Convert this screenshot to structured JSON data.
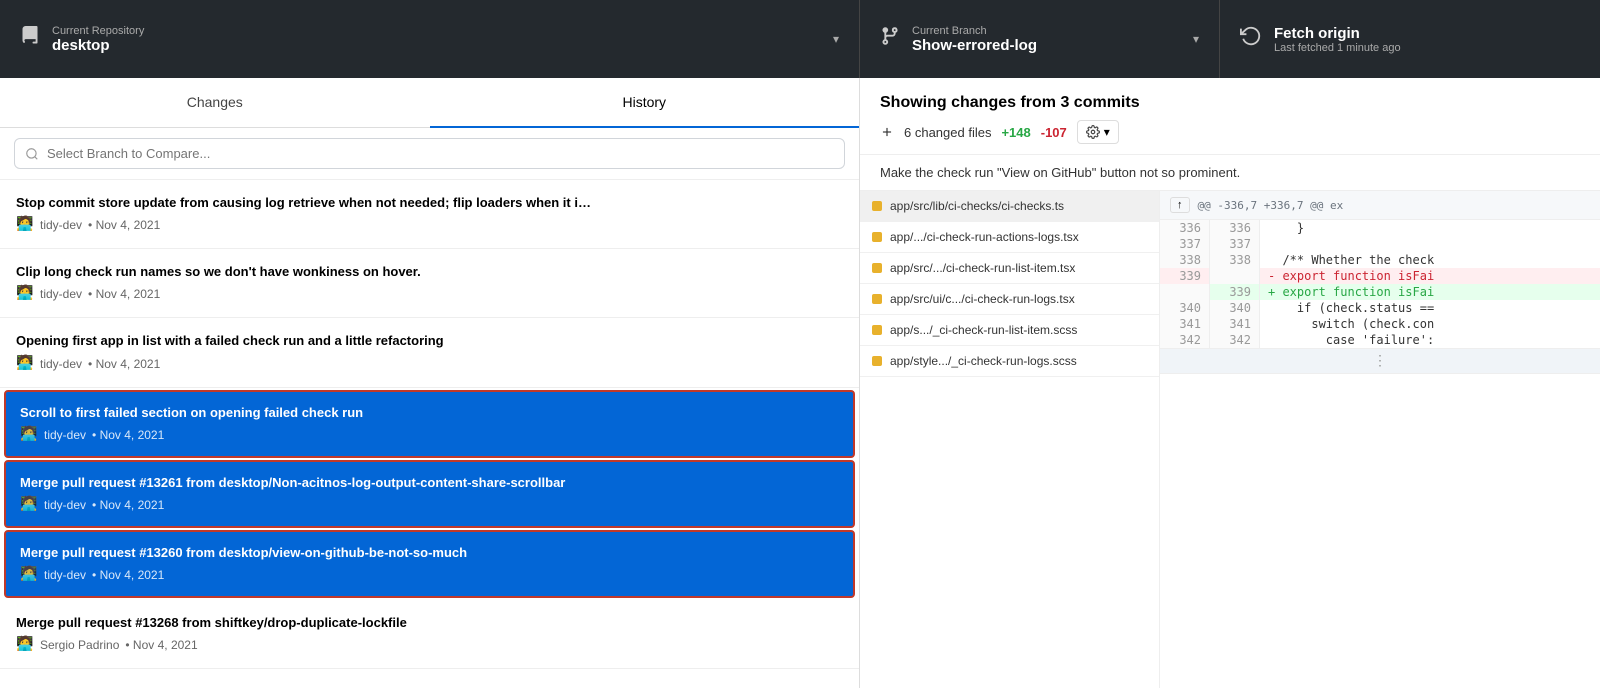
{
  "topbar": {
    "repo_label": "Current Repository",
    "repo_name": "desktop",
    "branch_label": "Current Branch",
    "branch_name": "Show-errored-log",
    "fetch_label": "Fetch origin",
    "fetch_sub": "Last fetched 1 minute ago"
  },
  "tabs": {
    "changes": "Changes",
    "history": "History"
  },
  "search": {
    "placeholder": "Select Branch to Compare..."
  },
  "commits": [
    {
      "title": "Stop commit store update from causing log retrieve when not needed; flip loaders when it i…",
      "author": "tidy-dev",
      "date": "Nov 4, 2021",
      "selected": false
    },
    {
      "title": "Clip long check run names so we don't have wonkiness on hover.",
      "author": "tidy-dev",
      "date": "Nov 4, 2021",
      "selected": false
    },
    {
      "title": "Opening first app in list with a failed check run and a little refactoring",
      "author": "tidy-dev",
      "date": "Nov 4, 2021",
      "selected": false
    },
    {
      "title": "Scroll to first failed section on opening failed check run",
      "author": "tidy-dev",
      "date": "Nov 4, 2021",
      "selected": true
    },
    {
      "title": "Merge pull request #13261 from desktop/Non-acitnos-log-output-content-share-scrollbar",
      "author": "tidy-dev",
      "date": "Nov 4, 2021",
      "selected": true
    },
    {
      "title": "Merge pull request #13260 from desktop/view-on-github-be-not-so-much",
      "author": "tidy-dev",
      "date": "Nov 4, 2021",
      "selected": true
    },
    {
      "title": "Merge pull request #13268 from shiftkey/drop-duplicate-lockfile",
      "author": "Sergio Padrino",
      "date": "Nov 4, 2021",
      "selected": false
    }
  ],
  "right": {
    "title": "Showing changes from 3 commits",
    "changed_files": "6 changed files",
    "additions": "+148",
    "deletions": "-107",
    "commit_message": "Make the check run \"View on GitHub\" button not so prominent."
  },
  "files": [
    {
      "name": "app/src/lib/ci-checks/ci-checks.ts",
      "active": true
    },
    {
      "name": "app/.../ci-check-run-actions-logs.tsx",
      "active": false
    },
    {
      "name": "app/src/.../ci-check-run-list-item.tsx",
      "active": false
    },
    {
      "name": "app/src/ui/c.../ci-check-run-logs.tsx",
      "active": false
    },
    {
      "name": "app/s.../_ci-check-run-list-item.scss",
      "active": false
    },
    {
      "name": "app/style.../_ci-check-run-logs.scss",
      "active": false
    }
  ],
  "diff": {
    "hunk_header": "@@ -336,7 +336,7 @@ ex",
    "lines": [
      {
        "num_left": "336",
        "num_right": "336",
        "type": "normal",
        "content": "    }"
      },
      {
        "num_left": "337",
        "num_right": "337",
        "type": "normal",
        "content": ""
      },
      {
        "num_left": "338",
        "num_right": "338",
        "type": "normal",
        "content": "  /** Whether the check"
      },
      {
        "num_left": "339",
        "num_right": "",
        "type": "del",
        "content": "- export function isFai"
      },
      {
        "num_left": "",
        "num_right": "339",
        "type": "add",
        "content": "+ export function isFai"
      },
      {
        "num_left": "340",
        "num_right": "340",
        "type": "normal",
        "content": "    if (check.status =="
      },
      {
        "num_left": "341",
        "num_right": "341",
        "type": "normal",
        "content": "      switch (check.con"
      },
      {
        "num_left": "342",
        "num_right": "342",
        "type": "normal",
        "content": "        case 'failure':"
      }
    ]
  }
}
